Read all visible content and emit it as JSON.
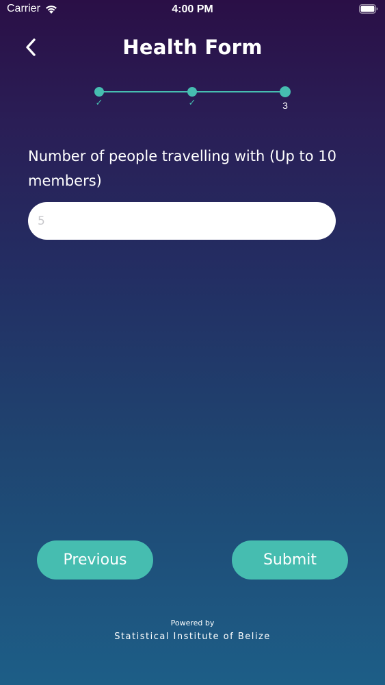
{
  "status_bar": {
    "carrier": "Carrier",
    "time": "4:00 PM",
    "icons": [
      "wifi-icon",
      "battery-icon"
    ]
  },
  "header": {
    "title": "Health Form",
    "back_icon": "chevron-left-icon"
  },
  "stepper": {
    "steps": [
      {
        "label": "✓",
        "state": "completed"
      },
      {
        "label": "✓",
        "state": "completed"
      },
      {
        "label": "3",
        "state": "current"
      }
    ],
    "accent_color": "#46bdb0"
  },
  "form": {
    "question": "Number of people travelling with (Up to 10 members)",
    "people_count": {
      "value": "",
      "placeholder": "5"
    }
  },
  "actions": {
    "previous_label": "Previous",
    "submit_label": "Submit",
    "button_color": "#46bdb0"
  },
  "footer": {
    "powered_by": "Powered by",
    "organization": "Statistical Institute of Belize"
  }
}
